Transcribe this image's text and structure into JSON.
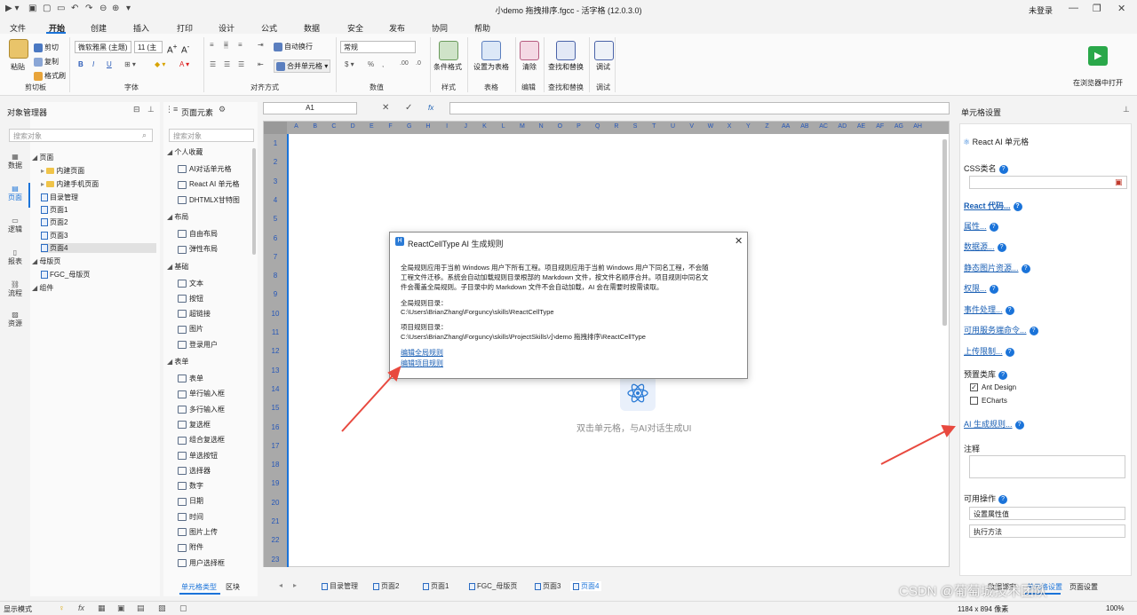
{
  "window": {
    "title": "小demo 拖拽排序.fgcc - 活字格 (12.0.3.0)",
    "login": "未登录"
  },
  "menu": [
    "文件",
    "开始",
    "创建",
    "插入",
    "打印",
    "设计",
    "公式",
    "数据",
    "安全",
    "发布",
    "协同",
    "帮助"
  ],
  "ribbon": {
    "paste": "粘贴",
    "cut": "剪切",
    "copy": "复制",
    "format_painter": "格式刷",
    "clipboard_group": "剪切板",
    "font_name": "微软雅黑 (主题)",
    "font_size": "11 (主",
    "font_group": "字体",
    "wrap_text": "自动换行",
    "merge_cells": "合并单元格",
    "align_group": "对齐方式",
    "number_format": "常规",
    "number_group": "数值",
    "conditional_format": "条件格式",
    "style_group": "样式",
    "set_as_table": "设置为表格",
    "table_group": "表格",
    "clear": "清除",
    "edit_group": "编辑",
    "find_replace": "查找和替换",
    "find_group": "查找和替换",
    "debug": "调试",
    "debug_group": "调试",
    "open_in_browser": "在浏览器中打开"
  },
  "object_manager": {
    "title": "对象管理器",
    "search_placeholder": "搜索对象",
    "side_tabs": [
      "数据",
      "页面",
      "逻辑",
      "报表",
      "流程",
      "资源"
    ],
    "tree": [
      {
        "label": "页面",
        "level": 0
      },
      {
        "label": "内建页面",
        "level": 1,
        "folder": true
      },
      {
        "label": "内建手机页面",
        "level": 1,
        "folder": true
      },
      {
        "label": "目录管理",
        "level": 1,
        "page": true
      },
      {
        "label": "页面1",
        "level": 1,
        "page": true
      },
      {
        "label": "页面2",
        "level": 1,
        "page": true
      },
      {
        "label": "页面3",
        "level": 1,
        "page": true
      },
      {
        "label": "页面4",
        "level": 1,
        "page": true,
        "selected": true
      },
      {
        "label": "母版页",
        "level": 0
      },
      {
        "label": "FGC_母版页",
        "level": 1,
        "page": true
      },
      {
        "label": "组件",
        "level": 0
      }
    ]
  },
  "page_elements": {
    "title": "页面元素",
    "search_placeholder": "搜索对象",
    "sections": [
      {
        "title": "个人收藏",
        "items": [
          "AI对话单元格",
          "React AI 单元格",
          "DHTMLX甘特图"
        ]
      },
      {
        "title": "布局",
        "items": [
          "自由布局",
          "弹性布局"
        ]
      },
      {
        "title": "基础",
        "items": [
          "文本",
          "按钮",
          "超链接",
          "图片",
          "登录用户"
        ]
      },
      {
        "title": "表单",
        "items": [
          "表单",
          "单行输入框",
          "多行输入框",
          "复选框",
          "组合复选框",
          "单选按钮",
          "选择器",
          "数字",
          "日期",
          "时间",
          "图片上传",
          "附件",
          "用户选择框"
        ]
      }
    ],
    "bottom_tabs": [
      "单元格类型",
      "区块"
    ]
  },
  "formula_bar": {
    "cell_ref": "A1",
    "fx": "fx"
  },
  "grid": {
    "columns": [
      "A",
      "B",
      "C",
      "D",
      "E",
      "F",
      "G",
      "H",
      "I",
      "J",
      "K",
      "L",
      "M",
      "N",
      "O",
      "P",
      "Q",
      "R",
      "S",
      "T",
      "U",
      "V",
      "W",
      "X",
      "Y",
      "Z",
      "AA",
      "AB",
      "AC",
      "AD",
      "AE",
      "AF",
      "AG",
      "AH"
    ],
    "rows": [
      "1",
      "2",
      "3",
      "4",
      "5",
      "6",
      "7",
      "8",
      "9",
      "10",
      "11",
      "12",
      "13",
      "14",
      "15",
      "16",
      "17",
      "18",
      "19",
      "20",
      "21",
      "22",
      "23"
    ],
    "placeholder": "双击单元格，与AI对话生成UI"
  },
  "sheet_tabs": [
    "目录管理",
    "页面2",
    "页面1",
    "FGC_母版页",
    "页面3",
    "页面4"
  ],
  "dialog": {
    "title": "ReactCellType AI 生成规则",
    "desc_lines": [
      "全局规则应用于当前 Windows 用户下所有工程。项目规则应用于当前 Windows 用户下同名工程，不会随",
      "工程文件迁移。系统会自动加载规则目录根部的 Markdown 文件，按文件名顺序合并。项目规则中同名文",
      "件会覆盖全局规则。子目录中的 Markdown 文件不会自动加载，AI 会在需要时按需读取。"
    ],
    "global_label": "全局规则目录：",
    "global_path": "C:\\Users\\BrianZhang\\Forguncy\\skills\\ReactCellType",
    "project_label": "项目规则目录：",
    "project_path": "C:\\Users\\BrianZhang\\Forguncy\\skills\\ProjectSkills\\小demo 拖拽排序\\ReactCellType",
    "edit_global": "编辑全局规则",
    "edit_project": "编辑项目规则"
  },
  "cell_settings": {
    "title": "单元格设置",
    "cell_type": "React AI 单元格",
    "css_class": "CSS类名",
    "links": [
      "React 代码...",
      "属性...",
      "数据源...",
      "静态图片资源...",
      "权限...",
      "事件处理...",
      "可用服务端命令...",
      "上传限制..."
    ],
    "preset_lib": "预置类库",
    "libs": [
      {
        "name": "Ant Design",
        "checked": true
      },
      {
        "name": "ECharts",
        "checked": false
      }
    ],
    "ai_rules": "AI 生成规则...",
    "comment": "注释",
    "available_ops": "可用操作",
    "ops": [
      "设置属性值",
      "执行方法"
    ],
    "bottom_tabs": [
      "数据绑定",
      "单元格设置",
      "页面设置"
    ]
  },
  "status": {
    "mode": "显示模式",
    "size": "1184 x 894 像素",
    "zoom": "100%",
    "watermark": "CSDN @葡萄城技术团队"
  },
  "colors": {
    "accent": "#1a73d9",
    "arrow": "#e8493f",
    "link": "#1a5fb4"
  }
}
